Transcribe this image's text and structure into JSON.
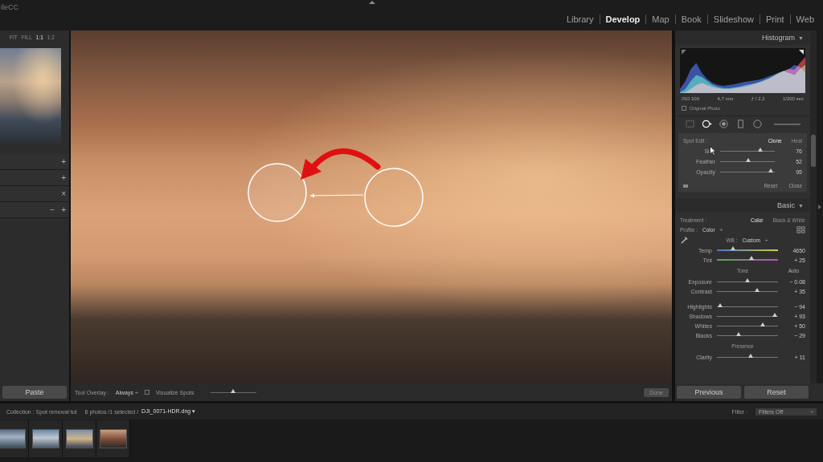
{
  "app": {
    "title": "ileCC"
  },
  "modules": [
    {
      "label": "Library",
      "selected": false
    },
    {
      "label": "Develop",
      "selected": true
    },
    {
      "label": "Map",
      "selected": false
    },
    {
      "label": "Book",
      "selected": false
    },
    {
      "label": "Slideshow",
      "selected": false
    },
    {
      "label": "Print",
      "selected": false
    },
    {
      "label": "Web",
      "selected": false
    }
  ],
  "navigator": {
    "zoom": [
      {
        "label": "FIT",
        "selected": false
      },
      {
        "label": "FILL",
        "selected": false
      },
      {
        "label": "1:1",
        "selected": true
      },
      {
        "label": "1:2",
        "selected": false
      }
    ]
  },
  "left_panels": [
    {
      "icons": [
        "+"
      ]
    },
    {
      "icons": [
        "+"
      ]
    },
    {
      "icons": [
        "×"
      ]
    },
    {
      "icons": [
        "−",
        "+"
      ]
    }
  ],
  "histogram": {
    "title": "Histogram",
    "arrow": "▼",
    "series": [
      {
        "color": "#3a5fe0",
        "values": [
          0.1,
          0.3,
          0.6,
          0.75,
          0.5,
          0.35,
          0.25,
          0.2,
          0.18,
          0.2,
          0.22,
          0.25,
          0.28,
          0.3,
          0.32,
          0.35,
          0.4,
          0.45,
          0.5,
          0.55,
          0.6,
          0.7,
          0.65,
          0.5
        ]
      },
      {
        "color": "#2fc060",
        "values": [
          0.02,
          0.1,
          0.3,
          0.45,
          0.4,
          0.3,
          0.2,
          0.15,
          0.12,
          0.12,
          0.14,
          0.16,
          0.2,
          0.22,
          0.25,
          0.3,
          0.35,
          0.42,
          0.5,
          0.55,
          0.5,
          0.45,
          0.6,
          0.7
        ]
      },
      {
        "color": "#e04040",
        "values": [
          0,
          0.02,
          0.1,
          0.2,
          0.25,
          0.2,
          0.15,
          0.12,
          0.1,
          0.1,
          0.12,
          0.14,
          0.16,
          0.2,
          0.24,
          0.28,
          0.34,
          0.4,
          0.48,
          0.55,
          0.6,
          0.58,
          0.75,
          0.9
        ]
      }
    ],
    "readouts": [
      "ISO 100",
      "4,7 mm",
      "ƒ / 2,2",
      "1/200 sec"
    ],
    "original_photo": {
      "label": "Original Photo",
      "checked": false
    }
  },
  "tools": [
    {
      "kind": "crop",
      "selected": false
    },
    {
      "kind": "spot",
      "selected": true
    },
    {
      "kind": "redeye",
      "selected": false
    },
    {
      "kind": "graduated",
      "selected": false
    },
    {
      "kind": "radial",
      "selected": false
    },
    {
      "kind": "brush",
      "selected": false
    }
  ],
  "spot_edit": {
    "label": "Spot Edit :",
    "modes": [
      {
        "label": "Clone",
        "selected": true
      },
      {
        "label": "Heal",
        "selected": false
      }
    ],
    "sliders": [
      {
        "label": "Size",
        "value": "76",
        "level": 0.74,
        "kind": "plain"
      },
      {
        "label": "Feather",
        "value": "52",
        "level": 0.52,
        "kind": "plain"
      },
      {
        "label": "Opacity",
        "value": "95",
        "level": 0.92,
        "kind": "plain"
      }
    ],
    "buttons": [
      "Reset",
      "Close"
    ]
  },
  "basic": {
    "title": "Basic",
    "arrow": "▼",
    "treatment": {
      "label": "Treatment :",
      "options": [
        {
          "label": "Color",
          "selected": true
        },
        {
          "label": "Black & White",
          "selected": false
        }
      ]
    },
    "profile": {
      "label": "Profile :",
      "value": "Color",
      "arrow": "÷"
    },
    "wb": {
      "label": "WB :",
      "value": "Custom",
      "arrow": "÷"
    },
    "wb_sliders": [
      {
        "label": "Temp",
        "value": "4650",
        "level": 0.26,
        "kind": "temp"
      },
      {
        "label": "Tint",
        "value": "+ 25",
        "level": 0.57,
        "kind": "tint"
      }
    ],
    "tone": {
      "label": "Tone",
      "auto": "Auto"
    },
    "tone_sliders": [
      {
        "label": "Exposure",
        "value": "− 0.08",
        "level": 0.5,
        "kind": "plain"
      },
      {
        "label": "Contrast",
        "value": "+ 35",
        "level": 0.66,
        "kind": "plain"
      }
    ],
    "tone_sliders2": [
      {
        "label": "Highlights",
        "value": "− 94",
        "level": 0.05,
        "kind": "plain"
      },
      {
        "label": "Shadows",
        "value": "+ 93",
        "level": 0.95,
        "kind": "plain"
      },
      {
        "label": "Whites",
        "value": "+ 50",
        "level": 0.75,
        "kind": "plain"
      },
      {
        "label": "Blacks",
        "value": "− 29",
        "level": 0.35,
        "kind": "plain"
      }
    ],
    "presence": {
      "label": "Presence"
    },
    "presence_sliders": [
      {
        "label": "Clarity",
        "value": "+ 11",
        "level": 0.55,
        "kind": "plain"
      }
    ]
  },
  "toolbar": {
    "paste": "Paste",
    "tool_overlay": {
      "label": "Tool Overlay :",
      "value": "Always",
      "arrow": "÷"
    },
    "visualize_spots": {
      "label": "Visualize Spots",
      "checked": false,
      "level": 0.5
    },
    "done": {
      "label": "Done",
      "disabled": true
    }
  },
  "right_buttons": [
    "Previous",
    "Reset"
  ],
  "filmstrip": {
    "collection": "Collection : Spot removal tut",
    "count": "6 photos /1 selected /",
    "file": "DJI_0071-HDR.dng",
    "arrow": "▾",
    "filter_label": "Filter :",
    "filter_value": "Filters Off",
    "filter_arrow": "÷"
  }
}
